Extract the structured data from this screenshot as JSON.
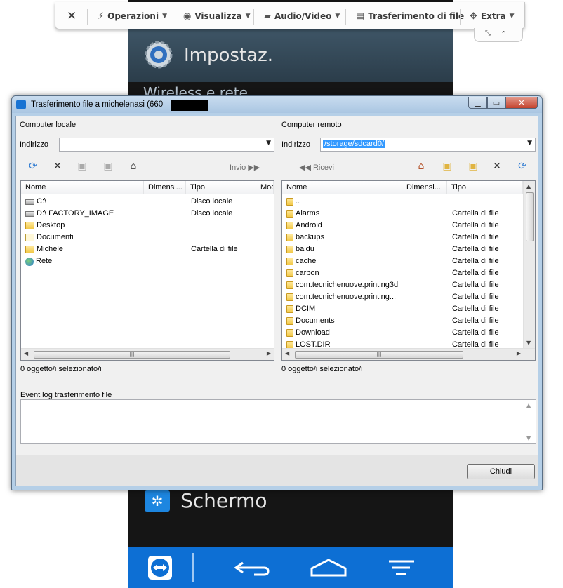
{
  "toolbar": {
    "items": [
      {
        "label": "Operazioni",
        "icon": "lightning-icon"
      },
      {
        "label": "Visualizza",
        "icon": "eye-icon"
      },
      {
        "label": "Audio/Video",
        "icon": "chat-icon"
      },
      {
        "label": "Trasferimento di file",
        "icon": "file-transfer-icon"
      },
      {
        "label": "Extra",
        "icon": "puzzle-icon"
      }
    ]
  },
  "phone": {
    "title": "Impostaz.",
    "subtitle": "Wireless e rete",
    "screen_label": "Schermo"
  },
  "dialog": {
    "title": "Trasferimento file a michelenasi (660",
    "close_label": "Chiudi",
    "event_log_label": "Event log trasferimento file"
  },
  "local": {
    "pane_label": "Computer locale",
    "address_label": "Indirizzo",
    "address_value": "",
    "send_label": "Invio",
    "columns": [
      "Nome",
      "Dimensi...",
      "Tipo",
      "Moc"
    ],
    "rows": [
      {
        "name": "C:\\",
        "type": "Disco locale",
        "icon": "local-disk-icon"
      },
      {
        "name": "D:\\  FACTORY_IMAGE",
        "type": "Disco locale",
        "icon": "drive-icon"
      },
      {
        "name": "Desktop",
        "type": "",
        "icon": "folder-icon"
      },
      {
        "name": "Documenti",
        "type": "",
        "icon": "documents-icon"
      },
      {
        "name": "Michele",
        "type": "Cartella di file",
        "icon": "folder-icon"
      },
      {
        "name": "Rete",
        "type": "",
        "icon": "network-icon"
      }
    ],
    "status": "0 oggetto/i selezionato/i"
  },
  "remote": {
    "pane_label": "Computer remoto",
    "address_label": "Indirizzo",
    "address_value": "/storage/sdcard0/",
    "receive_label": "Ricevi",
    "columns": [
      "Nome",
      "Dimensi...",
      "Tipo"
    ],
    "rows": [
      {
        "name": "..",
        "type": ""
      },
      {
        "name": "Alarms",
        "type": "Cartella di file"
      },
      {
        "name": "Android",
        "type": "Cartella di file"
      },
      {
        "name": "backups",
        "type": "Cartella di file"
      },
      {
        "name": "baidu",
        "type": "Cartella di file"
      },
      {
        "name": "cache",
        "type": "Cartella di file"
      },
      {
        "name": "carbon",
        "type": "Cartella di file"
      },
      {
        "name": "com.tecnichenuove.printing3d",
        "type": "Cartella di file"
      },
      {
        "name": "com.tecnichenuove.printing...",
        "type": "Cartella di file"
      },
      {
        "name": "DCIM",
        "type": "Cartella di file"
      },
      {
        "name": "Documents",
        "type": "Cartella di file"
      },
      {
        "name": "Download",
        "type": "Cartella di file"
      },
      {
        "name": "LOST.DIR",
        "type": "Cartella di file"
      }
    ],
    "status": "0 oggetto/i selezionato/i"
  },
  "colors": {
    "phone_navbar": "#0d6fd4",
    "selection": "#3399ff",
    "window_frame": "#b5cfe7"
  }
}
